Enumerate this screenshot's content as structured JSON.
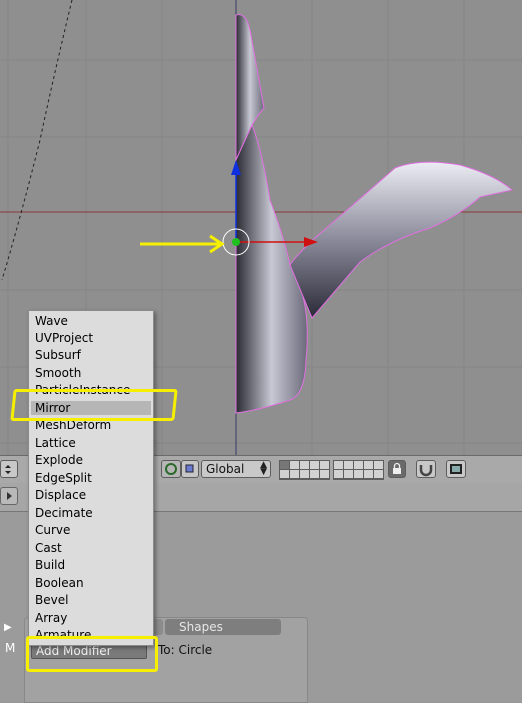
{
  "header": {
    "transform_orientation": "Global"
  },
  "properties": {
    "tab_shapes": "Shapes",
    "add_modifier_label": "Add Modifier",
    "to_object_label": "To: Circle",
    "side_m_label": "M"
  },
  "modifier_menu": {
    "items": [
      "Wave",
      "UVProject",
      "Subsurf",
      "Smooth",
      "ParticleInstance",
      "Mirror",
      "MeshDeform",
      "Lattice",
      "Explode",
      "EdgeSplit",
      "Displace",
      "Decimate",
      "Curve",
      "Cast",
      "Build",
      "Boolean",
      "Bevel",
      "Array",
      "Armature"
    ],
    "selected": "Mirror"
  },
  "colors": {
    "annotation_yellow": "#f6f000",
    "x_axis_red": "#d01010",
    "z_axis_blue": "#1030e0",
    "center_green": "#20c020"
  },
  "icons": {
    "manipulator": "rotate-manipulator-icon",
    "lock": "lock-icon",
    "magnet": "snap-magnet-icon",
    "render": "render-preview-icon"
  }
}
